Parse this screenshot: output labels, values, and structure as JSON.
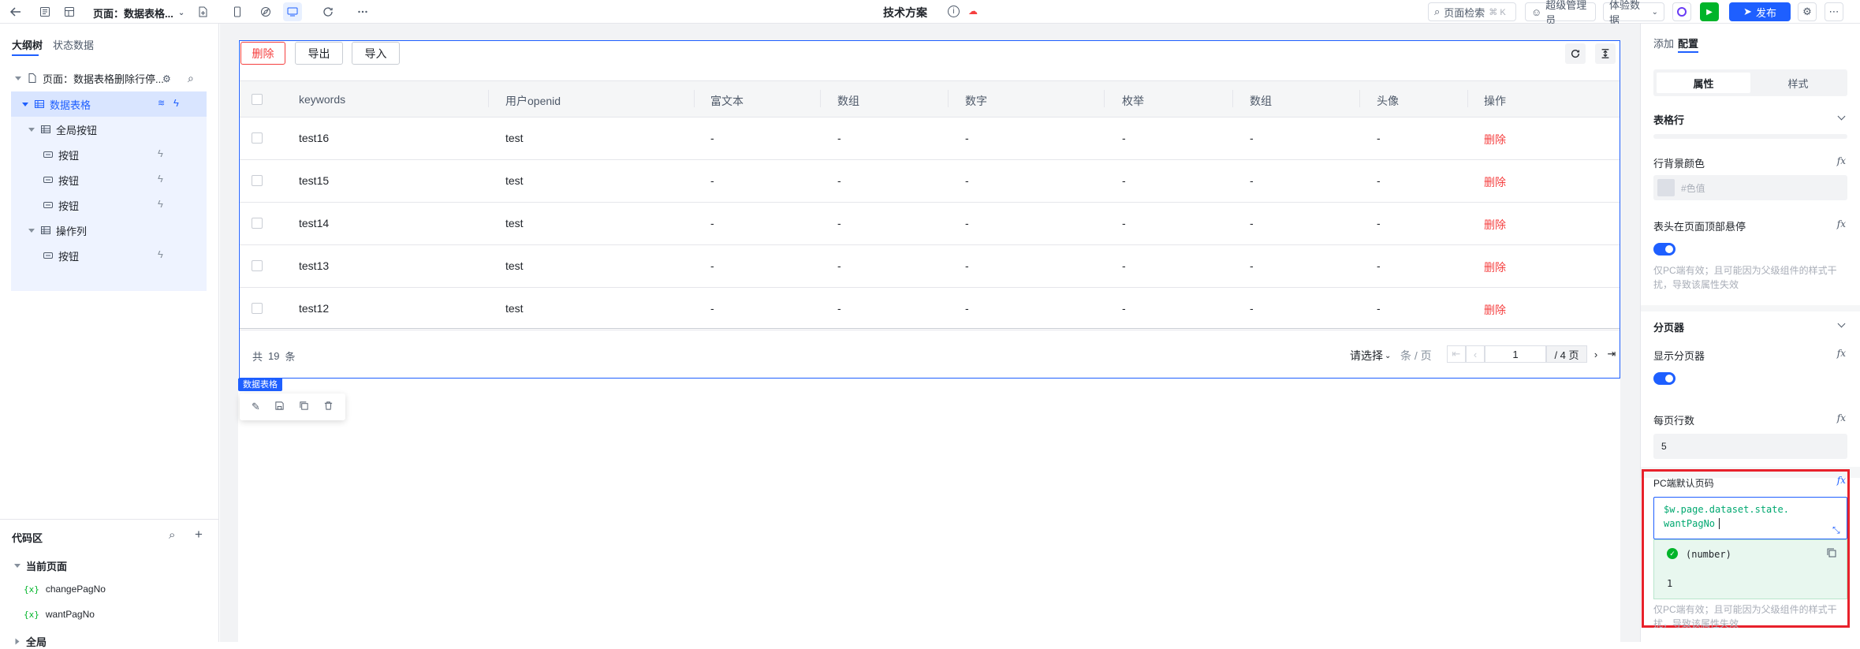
{
  "topbar": {
    "page_selector": "页面：数据表格...",
    "title": "技术方案",
    "search_label": "页面检索",
    "search_shortcut": "⌘ K",
    "user_label": "超级管理员",
    "env_label": "体验数据",
    "publish_label": "发布"
  },
  "left": {
    "tabs": [
      "大纲树",
      "状态数据"
    ],
    "tree": [
      {
        "label": "页面：数据表格删除行停...",
        "icon": "page-icon"
      },
      {
        "label": "数据表格",
        "icon": "table-icon"
      },
      {
        "label": "全局按钮",
        "icon": "table-icon"
      },
      {
        "label": "按钮",
        "icon": "button-icon"
      },
      {
        "label": "按钮",
        "icon": "button-icon"
      },
      {
        "label": "按钮",
        "icon": "button-icon"
      },
      {
        "label": "操作列",
        "icon": "table-icon"
      },
      {
        "label": "按钮",
        "icon": "button-icon"
      }
    ],
    "code_area": {
      "title": "代码区",
      "current_page": "当前页面",
      "vars": [
        "changePagNo",
        "wantPagNo"
      ],
      "var_prefix": "{x}",
      "global": "全局"
    }
  },
  "canvas": {
    "buttons": {
      "delete": "删除",
      "export": "导出",
      "import": "导入"
    },
    "columns": [
      "keywords",
      "用户openid",
      "富文本",
      "数组",
      "数字",
      "枚举",
      "数组",
      "头像",
      "操作"
    ],
    "rows": [
      {
        "keywords": "test16",
        "openid": "test",
        "cells": [
          "-",
          "-",
          "-",
          "-",
          "-",
          "-"
        ],
        "action": "删除"
      },
      {
        "keywords": "test15",
        "openid": "test",
        "cells": [
          "-",
          "-",
          "-",
          "-",
          "-",
          "-"
        ],
        "action": "删除"
      },
      {
        "keywords": "test14",
        "openid": "test",
        "cells": [
          "-",
          "-",
          "-",
          "-",
          "-",
          "-"
        ],
        "action": "删除"
      },
      {
        "keywords": "test13",
        "openid": "test",
        "cells": [
          "-",
          "-",
          "-",
          "-",
          "-",
          "-"
        ],
        "action": "删除"
      },
      {
        "keywords": "test12",
        "openid": "test",
        "cells": [
          "-",
          "-",
          "-",
          "-",
          "-",
          "-"
        ],
        "action": "删除"
      }
    ],
    "total_prefix": "共",
    "total_count": "19",
    "total_suffix": "条",
    "page_size_select": "请选择",
    "per_page": "条 / 页",
    "current_page": "1",
    "total_pages": "/ 4 页",
    "selected_tag": "数据表格"
  },
  "right": {
    "tabs": [
      "添加",
      "配置"
    ],
    "subtabs": [
      "属性",
      "样式"
    ],
    "section_row": "表格行",
    "row_bg_label": "行背景颜色",
    "color_placeholder": "#色值",
    "sticky_label": "表头在页面顶部悬停",
    "hint_pc": "仅PC端有效；且可能因为父级组件的样式干扰，导致该属性失效",
    "section_pager": "分页器",
    "show_pager_label": "显示分页器",
    "page_rows_label": "每页行数",
    "page_rows_value": "5",
    "default_page_label": "PC端默认页码",
    "expr_line1": "$w.page.dataset.state.",
    "expr_line2": "wantPagNo",
    "result_type": "(number)",
    "result_value": "1",
    "fx_label": "fx",
    "highlight_color": "#e8212b",
    "accent_color": "#1e5fff"
  }
}
